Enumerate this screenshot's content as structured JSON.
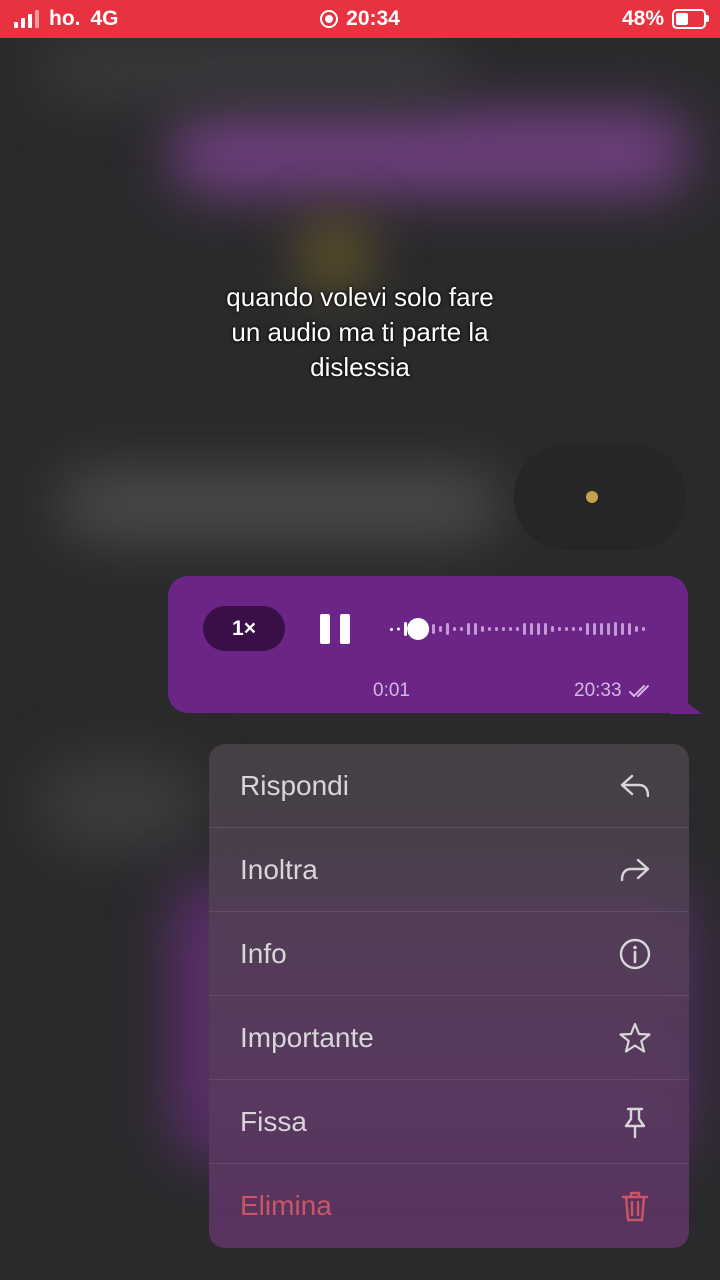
{
  "status_bar": {
    "carrier": "ho.",
    "network": "4G",
    "time": "20:34",
    "battery_percent_label": "48%",
    "battery_level": 0.48,
    "background_color": "#e8323f"
  },
  "caption": {
    "lines": [
      "quando volevi solo fare",
      "un audio ma ti parte la",
      "dislessia"
    ]
  },
  "voice_message": {
    "speed_label": "1×",
    "state": "playing",
    "position_label": "0:01",
    "sent_time": "20:33",
    "progress": 0.07,
    "bubble_color": "#6b2586",
    "read_icon": "double-check-icon"
  },
  "context_menu": {
    "items": [
      {
        "label": "Rispondi",
        "icon": "reply-icon"
      },
      {
        "label": "Inoltra",
        "icon": "forward-icon"
      },
      {
        "label": "Info",
        "icon": "info-icon"
      },
      {
        "label": "Importante",
        "icon": "star-icon"
      },
      {
        "label": "Fissa",
        "icon": "pin-icon"
      },
      {
        "label": "Elimina",
        "icon": "trash-icon",
        "danger_color": "#cc5565"
      }
    ]
  }
}
